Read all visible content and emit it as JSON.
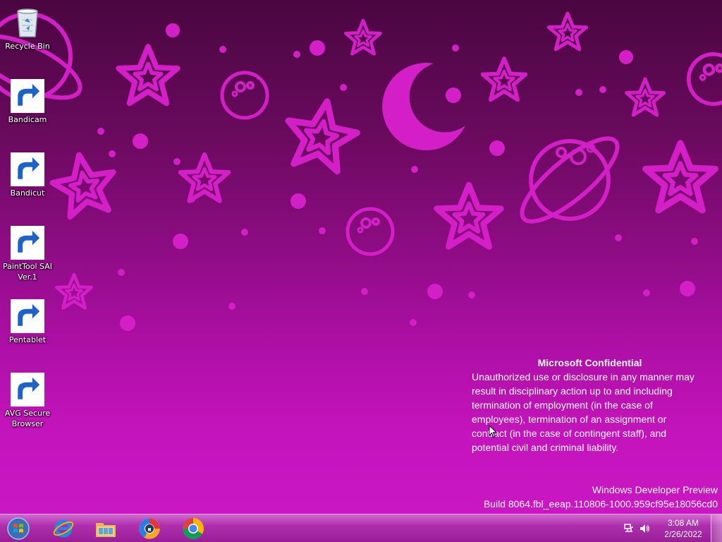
{
  "desktop_icons": [
    {
      "label": "Recycle Bin",
      "icon": "recycle-bin-icon"
    },
    {
      "label": "Bandicam",
      "icon": "bandicam-icon"
    },
    {
      "label": "Bandicut",
      "icon": "bandicut-icon"
    },
    {
      "label": "PaintTool SAI Ver.1",
      "icon": "painttool-sai-icon"
    },
    {
      "label": "Pentablet",
      "icon": "pentablet-icon"
    },
    {
      "label": "AVG Secure Browser",
      "icon": "avg-secure-browser-icon"
    }
  ],
  "watermark": {
    "title": "Microsoft Confidential",
    "lines": [
      "Unauthorized use or disclosure in any manner may",
      "result in disciplinary action up to and including",
      "termination of employment (in the case of",
      "employees), termination of an assignment or",
      "contract (in the case of contingent staff), and",
      "potential civil and criminal liability."
    ]
  },
  "build": {
    "edition": "Windows Developer Preview",
    "number": "Build 8064.fbl_eeap.110806-1000.959cf95e18056cd0"
  },
  "taskbar": {
    "pinned": [
      "internet-explorer-icon",
      "file-explorer-icon",
      "avg-secure-browser-icon",
      "chrome-icon"
    ],
    "clock_time": "3:08 AM",
    "clock_date": "2/26/2022"
  },
  "colors": {
    "wallpaper_shape": "#d41fc9",
    "taskbar": "#b02ab0"
  }
}
